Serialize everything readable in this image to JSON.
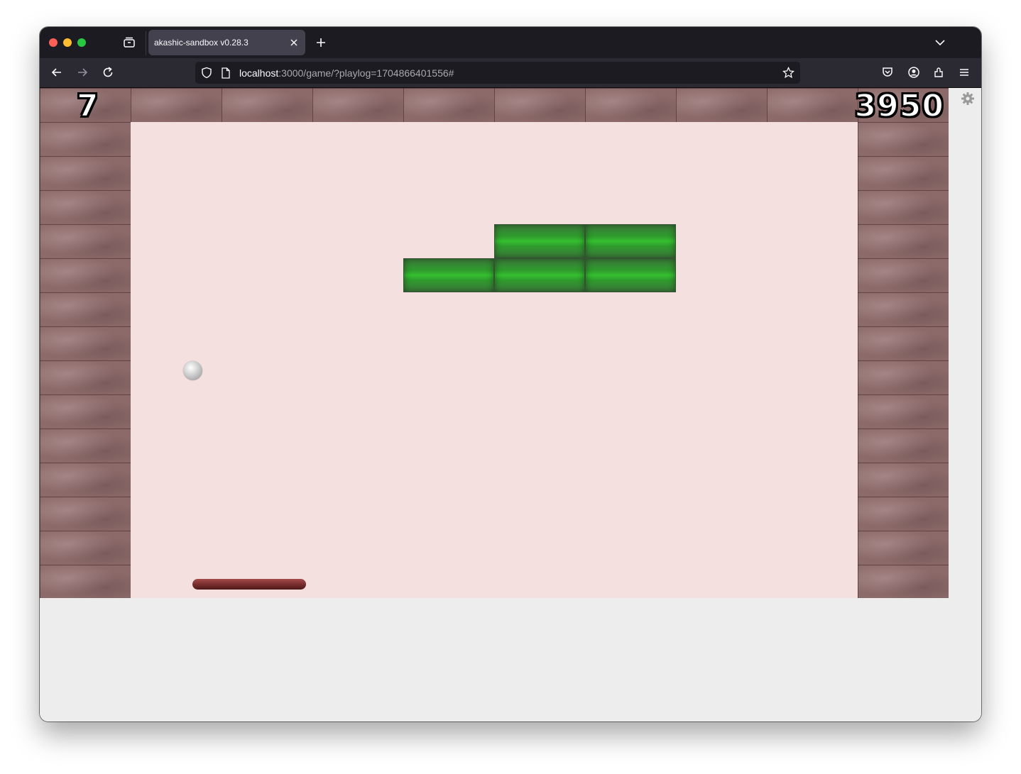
{
  "browser": {
    "tab_title": "akashic-sandbox v0.28.3",
    "url_host": "localhost",
    "url_rest": ":3000/game/?playlog=1704866401556#"
  },
  "game": {
    "lives": "7",
    "score": "3950",
    "bricks_color": "#36c031",
    "paddle_color": "#7a2e2e",
    "background_color": "#f5e0e0"
  },
  "icons": {
    "settings": "gear-icon"
  }
}
